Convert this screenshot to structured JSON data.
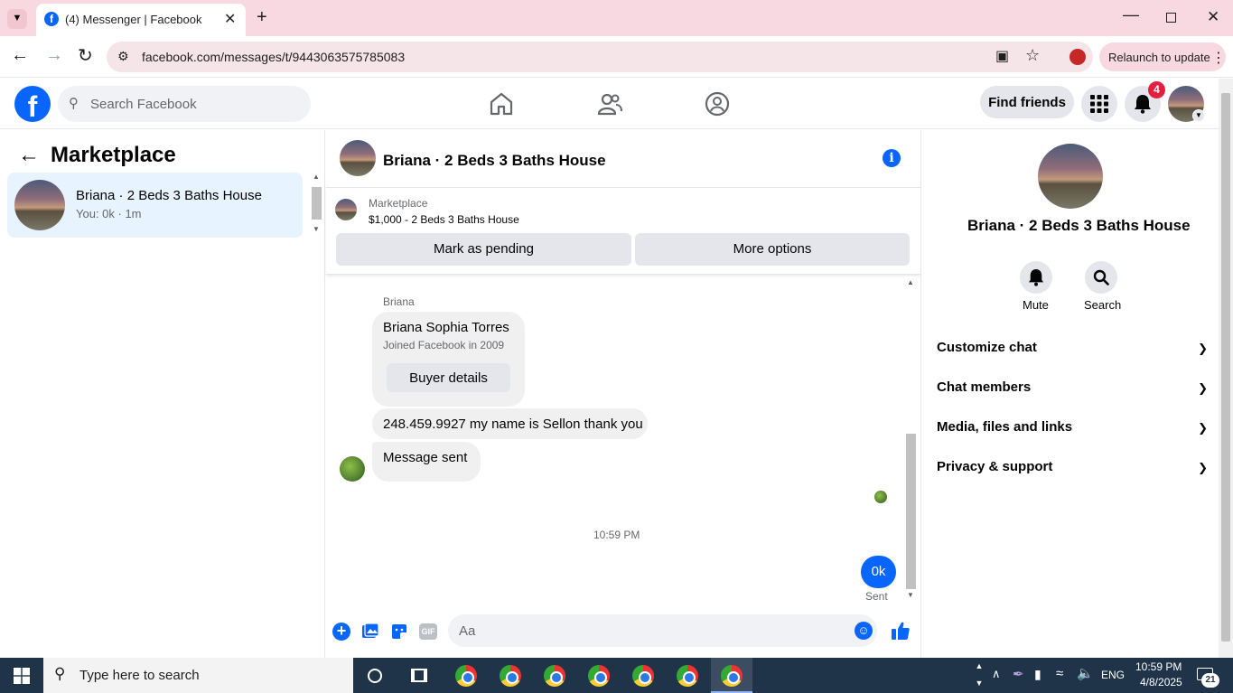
{
  "browser": {
    "tab_title": "(4) Messenger | Facebook",
    "url": "facebook.com/messages/t/9443063575785083",
    "relaunch_label": "Relaunch to update"
  },
  "fb_header": {
    "search_placeholder": "Search Facebook",
    "find_friends_label": "Find friends",
    "notification_count": "4"
  },
  "left_panel": {
    "title": "Marketplace",
    "conversations": [
      {
        "name": "Briana · 2 Beds 3 Baths House",
        "preview": "You: 0k · 1m"
      }
    ]
  },
  "chat": {
    "title": "Briana · 2 Beds 3 Baths House",
    "listing": {
      "label": "Marketplace",
      "price_title": "$1,000 - 2 Beds 3 Baths House"
    },
    "mark_pending_label": "Mark as pending",
    "more_options_label": "More options",
    "sender_name": "Briana",
    "buyer_card": {
      "name": "Briana Sophia Torres",
      "joined": "Joined Facebook in 2009",
      "details_button": "Buyer details"
    },
    "messages": [
      {
        "text": "248.459.9927 my name is Sellon thank you"
      },
      {
        "text": "Message sent"
      }
    ],
    "timestamp": "10:59 PM",
    "own_message": {
      "text": "0k",
      "status": "Sent"
    },
    "composer_placeholder": "Aa",
    "accent_color": "#0866ff"
  },
  "right_panel": {
    "name": "Briana · 2 Beds 3 Baths House",
    "mute_label": "Mute",
    "search_label": "Search",
    "sections": [
      "Customize chat",
      "Chat members",
      "Media, files and links",
      "Privacy & support"
    ]
  },
  "taskbar": {
    "search_placeholder": "Type here to search",
    "language": "ENG",
    "time": "10:59 PM",
    "date": "4/8/2025",
    "notification_count": "21"
  }
}
